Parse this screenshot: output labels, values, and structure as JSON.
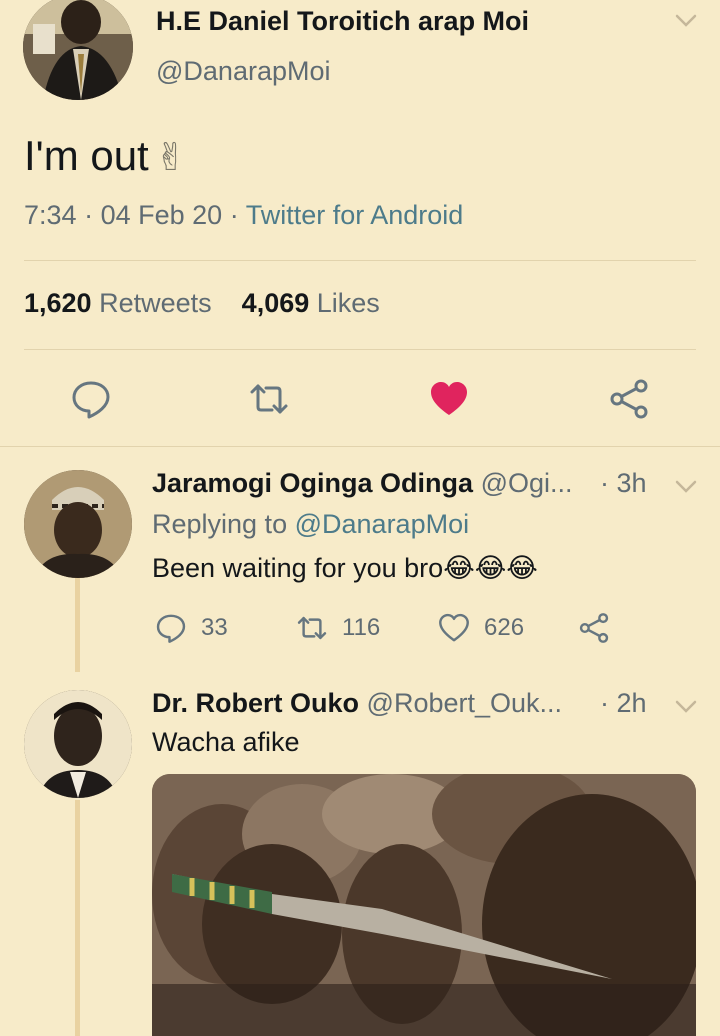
{
  "main_tweet": {
    "author_name": "H.E Daniel Toroitich arap Moi",
    "author_handle": "@DanarapMoi",
    "text": "I'm out",
    "emoji": "✌",
    "time": "7:34",
    "date": "04 Feb 20",
    "source": "Twitter for Android",
    "retweets_count": "1,620",
    "retweets_label": "Retweets",
    "likes_count": "4,069",
    "likes_label": "Likes",
    "liked": true
  },
  "replies": [
    {
      "author_name": "Jaramogi Oginga Odinga",
      "author_handle": "@Ogi...",
      "time": "· 3h",
      "replying_prefix": "Replying to",
      "replying_to": "@DanarapMoi",
      "text": "Been waiting for you bro",
      "emoji": "😂😂😂",
      "reply_count": "33",
      "retweet_count": "116",
      "like_count": "626"
    },
    {
      "author_name": "Dr. Robert Ouko",
      "author_handle": "@Robert_Ouk...",
      "time": "· 2h",
      "text": "Wacha afike",
      "has_media": true
    }
  ],
  "icons": {
    "reply": "reply-icon",
    "retweet": "retweet-icon",
    "like": "heart-icon",
    "share": "share-icon",
    "menu": "chevron-down-icon"
  },
  "colors": {
    "background": "#f7ebc9",
    "like_active": "#e0245e",
    "link": "#4d7b8a",
    "muted": "#5f6b73"
  }
}
